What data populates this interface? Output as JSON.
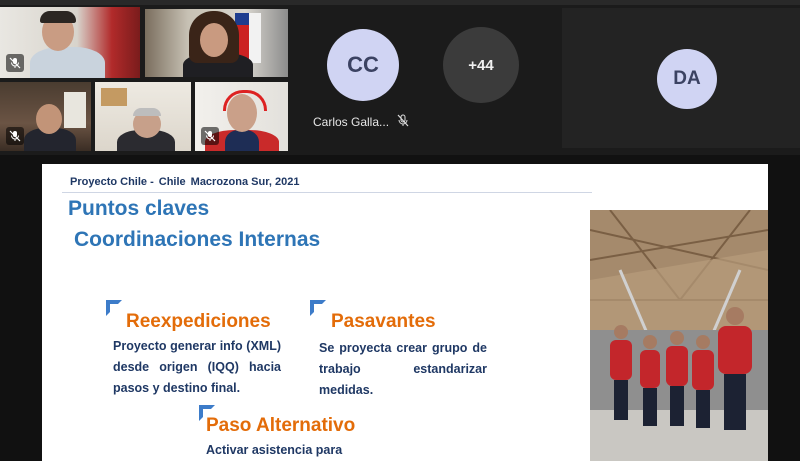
{
  "meeting": {
    "participants": [
      {
        "name": "Carlos Galla...",
        "initials": "CC"
      },
      {
        "initials": "DA"
      }
    ],
    "overflow_count": "+44"
  },
  "slide": {
    "project_parts": [
      "Proyecto Chile -",
      "Chile",
      "Macrozona Sur, 2021"
    ],
    "title": "Puntos claves",
    "subtitle": "Coordinaciones Internas",
    "sections": [
      {
        "heading": "Reexpediciones",
        "body": "Proyecto generar info (XML) desde origen (IQQ) hacia pasos y destino final."
      },
      {
        "heading": "Pasavantes",
        "body": "Se proyecta crear grupo de trabajo estandarizar medidas."
      },
      {
        "heading": "Paso Alternativo",
        "body": "Activar asistencia para"
      }
    ]
  },
  "colors": {
    "accent": "#7f85f5",
    "slide_title": "#2e75b6",
    "slide_heading": "#e36c09",
    "slide_text": "#1f3864"
  }
}
